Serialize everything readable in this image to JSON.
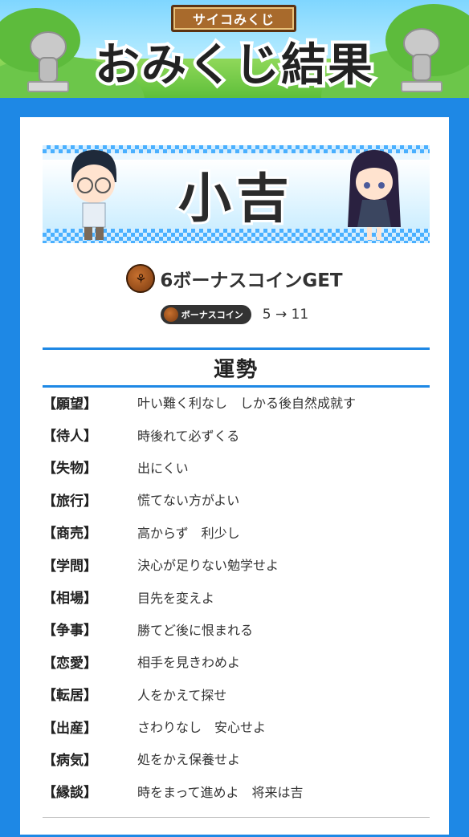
{
  "header": {
    "sign_label": "サイコみくじ",
    "title": "おみくじ結果"
  },
  "result": {
    "fortune": "小吉",
    "bonus_text": "6ボーナスコインGET",
    "coin_icon": "coin-icon",
    "pill_label": "ボーナスコイン",
    "coin_change": "5 → 11"
  },
  "section": {
    "title": "運勢"
  },
  "fortunes": [
    {
      "category": "【願望】",
      "text": "叶い難く利なし　しかる後自然成就す"
    },
    {
      "category": "【待人】",
      "text": "時後れて必ずくる"
    },
    {
      "category": "【失物】",
      "text": "出にくい"
    },
    {
      "category": "【旅行】",
      "text": "慌てない方がよい"
    },
    {
      "category": "【商売】",
      "text": "高からず　利少し"
    },
    {
      "category": "【学問】",
      "text": "決心が足りない勉学せよ"
    },
    {
      "category": "【相場】",
      "text": "目先を変えよ"
    },
    {
      "category": "【争事】",
      "text": "勝てど後に恨まれる"
    },
    {
      "category": "【恋愛】",
      "text": "相手を見きわめよ"
    },
    {
      "category": "【転居】",
      "text": "人をかえて探せ"
    },
    {
      "category": "【出産】",
      "text": "さわりなし　安心せよ"
    },
    {
      "category": "【病気】",
      "text": "処をかえ保養せよ"
    },
    {
      "category": "【縁談】",
      "text": "時をまって進めよ　将来は吉"
    }
  ],
  "colors": {
    "accent": "#1e88e5",
    "coin": "#a0521c"
  }
}
